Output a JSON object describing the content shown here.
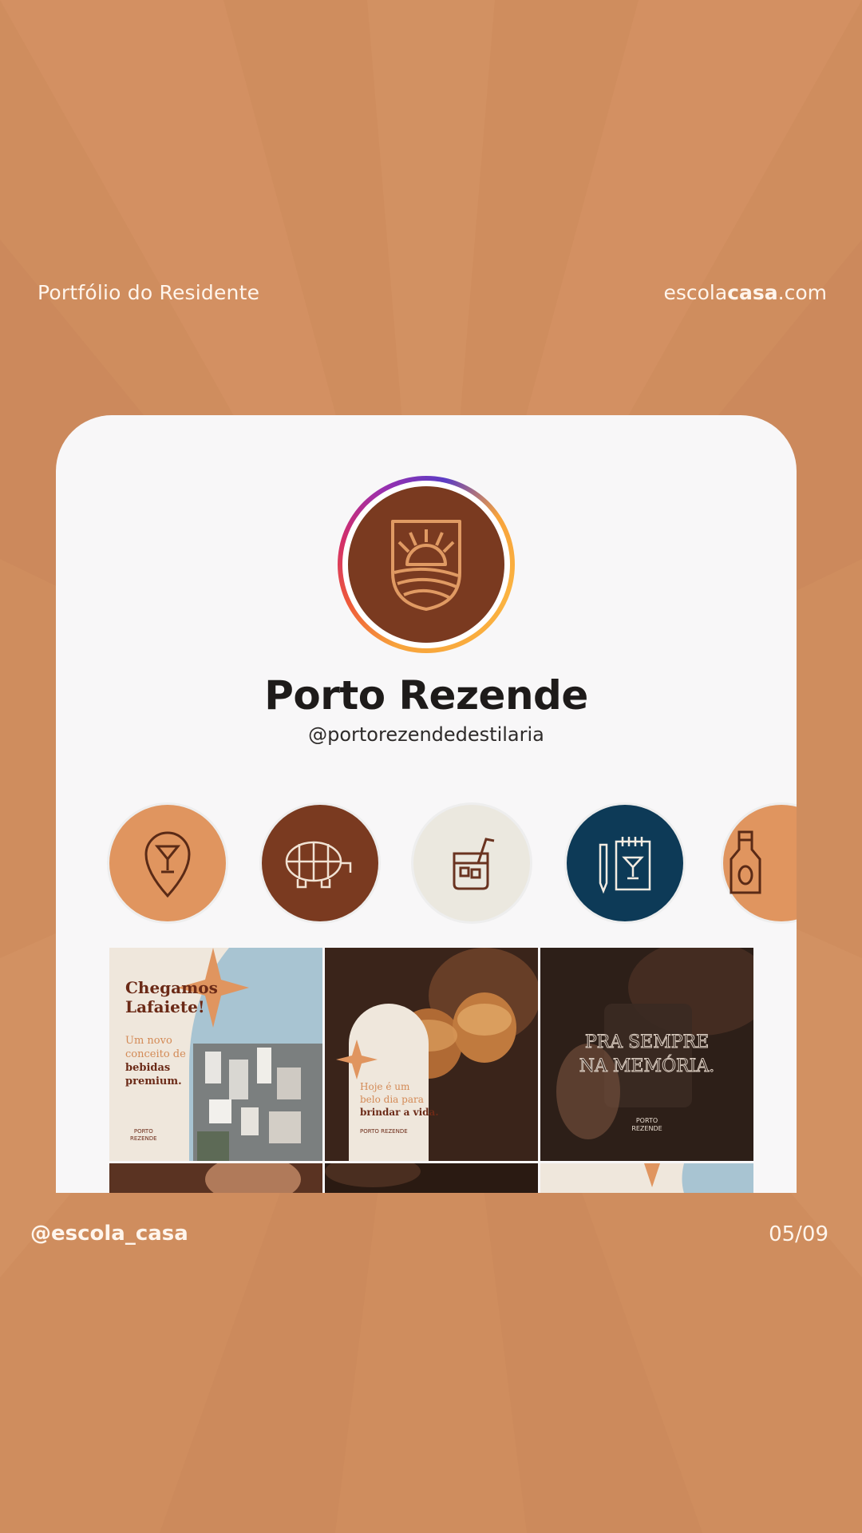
{
  "header": {
    "left_text": "Portfólio do Residente",
    "site_prefix": "escola",
    "site_bold": "casa",
    "site_suffix": ".com"
  },
  "footer": {
    "handle": "@escola_casa",
    "page_counter": "05/09"
  },
  "profile": {
    "name": "Porto Rezende",
    "handle": "@portorezendedestilaria"
  },
  "highlights": [
    {
      "icon": "location-cocktail-icon",
      "color": "#e0955f"
    },
    {
      "icon": "barrel-icon",
      "color": "#7a3a20"
    },
    {
      "icon": "drink-glass-icon",
      "color": "#ebe8df"
    },
    {
      "icon": "menu-notepad-icon",
      "color": "#0d3a57"
    },
    {
      "icon": "bottle-icon",
      "color": "#e0955f"
    }
  ],
  "posts": {
    "post1": {
      "title_line1": "Chegamos",
      "title_line2": "Lafaiete!",
      "body_line1": "Um novo",
      "body_line2": "conceito de",
      "body_line3": "bebidas",
      "body_line4": "premium.",
      "logo_line1": "PORTO",
      "logo_line2": "REZENDE"
    },
    "post2": {
      "line1": "Hoje é um",
      "line2": "belo dia para",
      "line3": "brindar a vida.",
      "logo": "PORTO REZENDE"
    },
    "post3": {
      "line1": "PRA SEMPRE",
      "line2": "NA MEMÓRIA.",
      "logo_line1": "PORTO",
      "logo_line2": "REZENDE"
    }
  },
  "colors": {
    "background": "#cf8d5e",
    "brand_brown": "#7a3a20",
    "brand_orange": "#e0955f",
    "navy": "#0d3a57"
  }
}
